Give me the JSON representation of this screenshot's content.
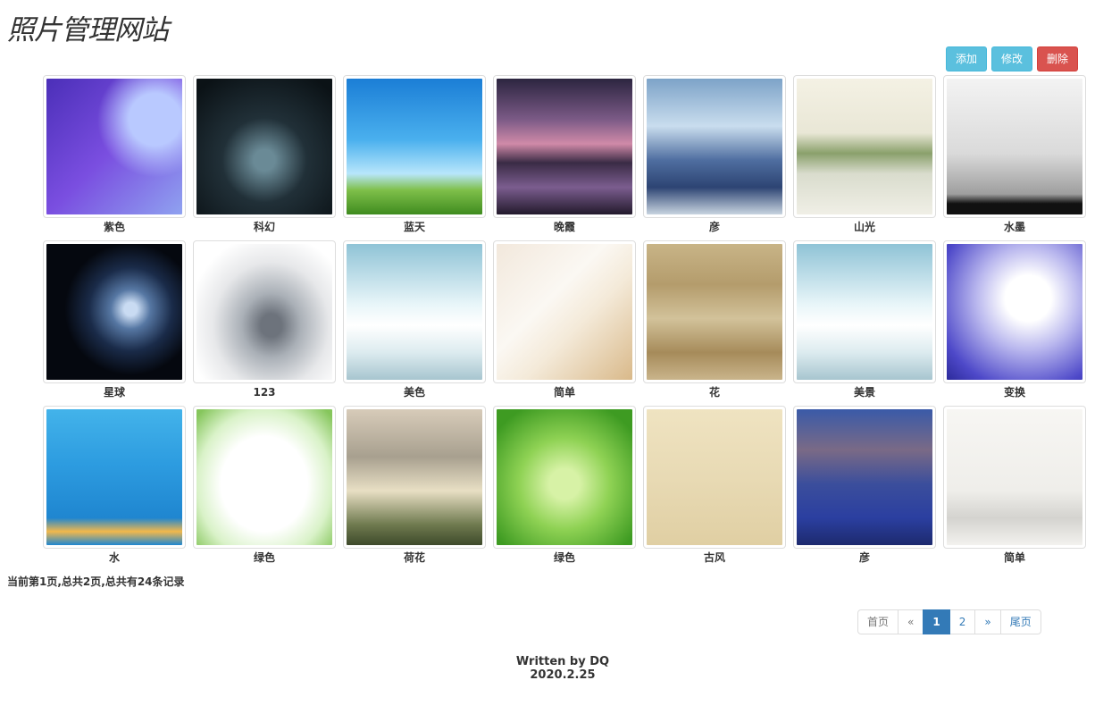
{
  "header": {
    "title": "照片管理网站"
  },
  "toolbar": {
    "add_label": "添加",
    "edit_label": "修改",
    "delete_label": "删除"
  },
  "gallery": {
    "photos": [
      {
        "caption": "紫色"
      },
      {
        "caption": "科幻"
      },
      {
        "caption": "蓝天"
      },
      {
        "caption": "晚霞"
      },
      {
        "caption": "彦"
      },
      {
        "caption": "山光"
      },
      {
        "caption": "水墨"
      },
      {
        "caption": "星球"
      },
      {
        "caption": "123"
      },
      {
        "caption": "美色"
      },
      {
        "caption": "简单"
      },
      {
        "caption": "花"
      },
      {
        "caption": "美景"
      },
      {
        "caption": "变换"
      },
      {
        "caption": "水"
      },
      {
        "caption": "绿色"
      },
      {
        "caption": "荷花"
      },
      {
        "caption": "绿色"
      },
      {
        "caption": "古风"
      },
      {
        "caption": "彦"
      },
      {
        "caption": "简单"
      }
    ]
  },
  "status": {
    "text": "当前第1页,总共2页,总共有24条记录"
  },
  "pagination": {
    "first": "首页",
    "prev": "«",
    "page1": "1",
    "page2": "2",
    "next": "»",
    "last": "尾页",
    "current_page": 1
  },
  "footer": {
    "line1": "Written by DQ",
    "line2": "2020.2.25"
  }
}
